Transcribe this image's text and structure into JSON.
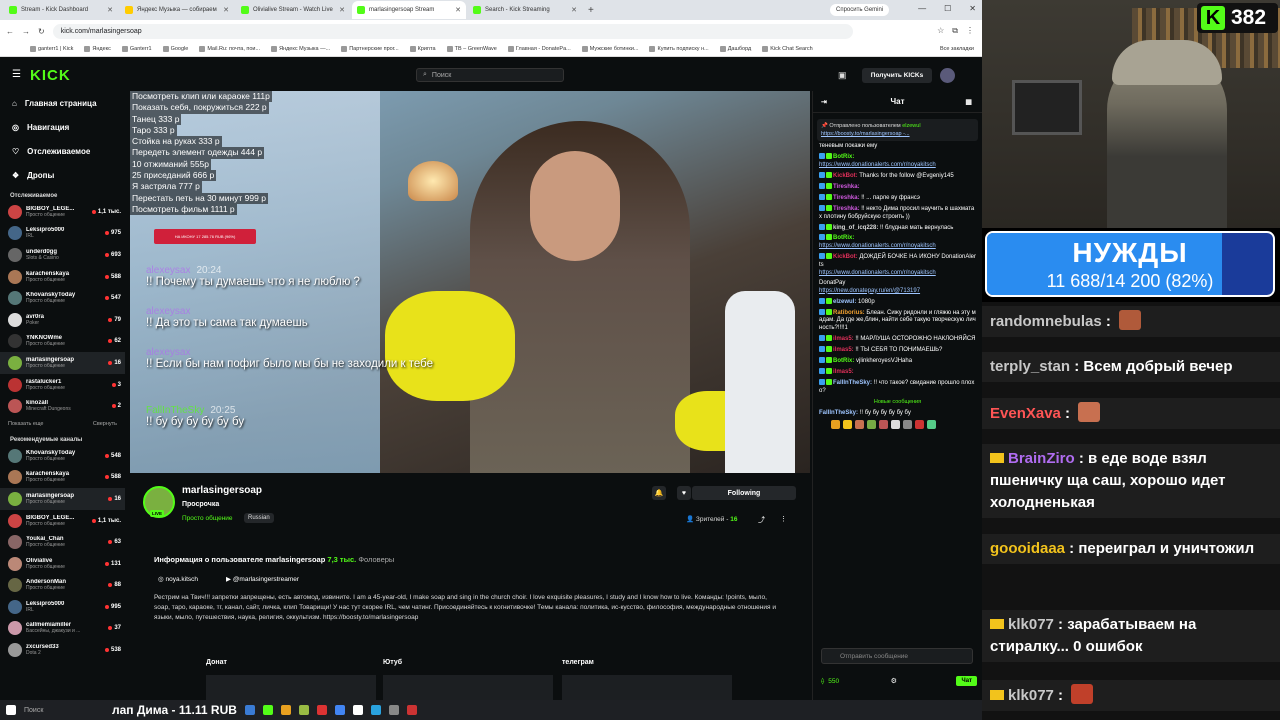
{
  "browser": {
    "tabs": [
      {
        "title": "Stream - Kick Dashboard",
        "color": "#53fc18",
        "active": false
      },
      {
        "title": "Яндекс Музыка — собираем",
        "color": "#ffcc00",
        "active": false
      },
      {
        "title": "Olivialive Stream - Watch Live",
        "color": "#53fc18",
        "active": false
      },
      {
        "title": "marlasingersoap Stream",
        "color": "#53fc18",
        "active": true
      },
      {
        "title": "Search - Kick Streaming",
        "color": "#53fc18",
        "active": false
      }
    ],
    "gemini_label": "Спросить Gemini",
    "url": "kick.com/marlasingersoap",
    "bookmarks": [
      "ganterr1 | Kick",
      "Яндекс",
      "Ganterr1",
      "Google",
      "Mail.Ru: почта, пои...",
      "Яндекс Музыка —...",
      "Партнерские прог...",
      "Криnта",
      "ТВ – GreenWave",
      "Главная - DonatePa...",
      "Мужские ботинки...",
      "Купить подписку н...",
      "Дашборд",
      "Kick Chat Search"
    ],
    "all_bookmarks": "Все закладки"
  },
  "header": {
    "search_placeholder": "Поиск",
    "get_kicks": "Получить KICKs"
  },
  "sidebar": {
    "nav": [
      {
        "label": "Главная страница",
        "icon": "home-icon"
      },
      {
        "label": "Навигация",
        "icon": "compass-icon"
      },
      {
        "label": "Отслеживаемое",
        "icon": "heart-icon"
      },
      {
        "label": "Дропы",
        "icon": "gift-icon"
      }
    ],
    "followed_title": "Отслеживаемое",
    "followed": [
      {
        "name": "BIGBOY_LEGE...",
        "cat": "Просто общение",
        "viewers": "1,1 тыс.",
        "color": "#c44"
      },
      {
        "name": "Leksipro5000",
        "cat": "IRL",
        "viewers": "975",
        "color": "#468"
      },
      {
        "name": "underd0gg",
        "cat": "Slots & Casino",
        "viewers": "693",
        "color": "#666"
      },
      {
        "name": "karachenskaya",
        "cat": "Просто общение",
        "viewers": "588",
        "color": "#a75"
      },
      {
        "name": "KhovanskyToday",
        "cat": "Просто общение",
        "viewers": "547",
        "color": "#577"
      },
      {
        "name": "avr0ra",
        "cat": "Poker",
        "viewers": "79",
        "color": "#ddd"
      },
      {
        "name": "YNKNOWme",
        "cat": "Просто общение",
        "viewers": "62",
        "color": "#333"
      },
      {
        "name": "marlasingersoap",
        "cat": "Просто общение",
        "viewers": "16",
        "color": "#7ab040",
        "highlight": true
      },
      {
        "name": "rastalucker1",
        "cat": "Просто общение",
        "viewers": "3",
        "color": "#b33"
      },
      {
        "name": "kinozall",
        "cat": "Minecraft Dungeons",
        "viewers": "2",
        "color": "#b55"
      }
    ],
    "show_more": "Показать еще",
    "collapse": "Свернуть",
    "recommended_title": "Рекомендуемые каналы",
    "recommended": [
      {
        "name": "KhovanskyToday",
        "cat": "Просто общение",
        "viewers": "548",
        "color": "#577"
      },
      {
        "name": "karachenskaya",
        "cat": "Просто общение",
        "viewers": "588",
        "color": "#a75"
      },
      {
        "name": "marlasingersoap",
        "cat": "Просто общение",
        "viewers": "16",
        "color": "#7ab040",
        "highlight": true
      },
      {
        "name": "BIGBOY_LEGE...",
        "cat": "Просто общение",
        "viewers": "1,1 тыс.",
        "color": "#c44"
      },
      {
        "name": "Youkai_Chan",
        "cat": "Просто общение",
        "viewers": "63",
        "color": "#866"
      },
      {
        "name": "Olivialive",
        "cat": "Просто общение",
        "viewers": "131",
        "color": "#b87"
      },
      {
        "name": "AndersonMan",
        "cat": "Просто общение",
        "viewers": "88",
        "color": "#664"
      },
      {
        "name": "Leksipro5000",
        "cat": "IRL",
        "viewers": "995",
        "color": "#468"
      },
      {
        "name": "callmemiamiller",
        "cat": "Бассейны, джакузи и ...",
        "viewers": "37",
        "color": "#c9a"
      },
      {
        "name": "zxcursed33",
        "cat": "Dota 2",
        "viewers": "538",
        "color": "#999"
      }
    ]
  },
  "video": {
    "menu": [
      "Посмотреть клип или караоке 111р",
      "Показать себя, покружиться 222 р",
      "Танец 333 р",
      "Таро 333 р",
      "Стойка на руках 333 р",
      "Передеть элемент одежды 444 р",
      "10 отжиманий 555р",
      "25 приседаний 666 р",
      "Я застряла 777 р",
      "Перестать петь на 30 минут 999 р",
      "Посмотреть фильм 1111 р"
    ],
    "goal_text": "НА ИКОНУ 17 285.76 RUB (96%)",
    "tts": [
      {
        "user": "alexeysax",
        "time": "20:24",
        "text": "!! Почему ты думаешь что я не люблю ?",
        "color": "#b06cf0"
      },
      {
        "user": "alexeysax",
        "time": "",
        "text": "!! Да это ты сама так думаешь",
        "color": "#b06cf0"
      },
      {
        "user": "alexeysax",
        "time": "",
        "text": "!! Если бы нам пофиг было мы бы не заходили к тебе",
        "color": "#b06cf0"
      },
      {
        "user": "FallInTheSky",
        "time": "20:25",
        "text": "!! бу бу бу бу бу бу",
        "color": "#53fc18"
      }
    ]
  },
  "stream": {
    "channel": "marlasingersoap",
    "title": "Просрочка",
    "category": "Просто общение",
    "language": "Russian",
    "follow_label": "Following",
    "viewers_label": "Зрителей",
    "viewers_count": "16",
    "about_prefix": "Информация о пользователе marlasingersoap",
    "followers_count": "7,3 тыс.",
    "followers_label": "Фоловеры",
    "social": [
      {
        "icon": "instagram-icon",
        "label": "noya.kitsch"
      },
      {
        "icon": "youtube-icon",
        "label": "@marlasingerstreamer"
      }
    ],
    "bio": "Рестрим на Твич!!! запретки запрещены, есть автомод, извините. I am a 45-year-old, I make soap and sing in the church choir. I love exquisite pleasures, I study and I know how to live. Команды: !points, мыло, soap, таро, караоке, тг, канал, сайт, личка, клип Товарищи! У нас тут скорее IRL, чем чатинг. Присоединяйтесь к когнитивочке! Темы канала: политика, ис-кусство, философия, международные отношения и языки, мыло, путешествия, наука, религия, оккультизм. https://boosty.to/marlasingersoap",
    "panels": [
      "Донат",
      "Ютуб",
      "телеграм"
    ]
  },
  "chat": {
    "title": "Чат",
    "pinned_by": "Отправлено пользователем",
    "pinned_user": "elzewul",
    "pinned_link": "https://boosty.to/marlasingersoap -...",
    "messages": [
      {
        "user": "",
        "text": "теневым покажи ему",
        "color": "#ddd",
        "link": ""
      },
      {
        "user": "BotRix:",
        "text": "",
        "color": "#53fc18",
        "link": "https://www.donationalerts.com/r/noyakitsch"
      },
      {
        "user": "KickBot:",
        "text": "Thanks for the follow @Evgeniy145",
        "color": "#e0305a",
        "link": ""
      },
      {
        "user": "Tireshka:",
        "text": "",
        "color": "#d05ae0",
        "link": ""
      },
      {
        "user": "Tireshka:",
        "text": "!! ... парле ву франсэ",
        "color": "#d05ae0",
        "link": ""
      },
      {
        "user": "Tireshka:",
        "text": "!! некто Дима просил научить в шахматах плотину бобруйскую строить ))",
        "color": "#d05ae0",
        "link": ""
      },
      {
        "user": "king_of_icq228:",
        "text": "!! блудная мать вернулась",
        "color": "#ddd",
        "link": ""
      },
      {
        "user": "BotRix:",
        "text": "",
        "color": "#53fc18",
        "link": "https://www.donationalerts.com/r/noyakitsch"
      },
      {
        "user": "KickBot:",
        "text": "ДОЖДЕЙ БОЧКЕ НА ИКОНУ DonationAlerts",
        "color": "#e0305a",
        "link": "https://www.donationalerts.com/r/noyakitsch"
      },
      {
        "user": "",
        "text": "DonatPay",
        "color": "#ddd",
        "link": "https://new.donatepay.ru/en/@713197"
      },
      {
        "user": "elzewul:",
        "text": "1080р",
        "color": "#9ec5ff",
        "link": ""
      },
      {
        "user": "Ratiborius:",
        "text": "Блеан. Сижу ридонли и гляжю на эту мадам. Да где же,блин, найти себе такую творческую личность?!!!!1",
        "color": "#f0a030",
        "link": ""
      },
      {
        "user": "ilmas5:",
        "text": "!! МАРЛУША ОСТОРОЖНО НАКЛОНЯЙСЯ",
        "color": "#e0305a",
        "link": ""
      },
      {
        "user": "ilmas5:",
        "text": "!! ТЫ СЕБЯ ТО ПОНИМАЕШЬ?",
        "color": "#e0305a",
        "link": ""
      },
      {
        "user": "BotRix:",
        "text": "vjlinkheroyesVJHaha",
        "color": "#53fc18",
        "link": ""
      },
      {
        "user": "ilmas5:",
        "text": "",
        "color": "#e0305a",
        "link": ""
      },
      {
        "user": "FallInTheSky:",
        "text": "!! что такое? свидание прошло плохо?",
        "color": "#9ec5ff",
        "link": ""
      }
    ],
    "new_messages": "Новые сообщения",
    "last_message": {
      "user": "FallInTheSky:",
      "text": "!! бу бу бу бу бу бу",
      "color": "#9ec5ff"
    },
    "input_placeholder": "Отправить сообщение",
    "points": "550",
    "send_label": "Чат"
  },
  "taskbar": {
    "search": "Поиск",
    "ticker": "лап Дима - 11.11 RUB"
  },
  "overlay": {
    "kick_count": "382",
    "goal_title": "НУЖДЫ",
    "goal_amount": "11 688/14 200 (82%)",
    "goal_fraction": 0.82,
    "chat": [
      {
        "user": "randomnebulas",
        "text": "",
        "color": "#c8c8c8",
        "crown": false,
        "emote": "#b05a3a"
      },
      {
        "user": "terply_stan",
        "text": "Всем добрый вечер",
        "color": "#c8c8c8",
        "crown": false,
        "emote": ""
      },
      {
        "user": "EvenXava",
        "text": "",
        "color": "#ff5555",
        "crown": false,
        "emote": "#c87050"
      },
      {
        "user": "BrainZiro",
        "text": "в еде воде взял пшеничку ща саш, хорошо идет холодненькая",
        "color": "#b06cf0",
        "crown": true,
        "emote": ""
      },
      {
        "user": "goooidaaa",
        "text": "переиграл и уничтожил",
        "color": "#f2c31c",
        "crown": false,
        "emote": ""
      },
      {
        "user": "klk077",
        "text": "зарабатываем на стиралку... 0 ошибок",
        "color": "#c8c8c8",
        "crown": true,
        "emote": ""
      },
      {
        "user": "klk077",
        "text": "",
        "color": "#c8c8c8",
        "crown": true,
        "emote": "#c0402a"
      }
    ]
  }
}
